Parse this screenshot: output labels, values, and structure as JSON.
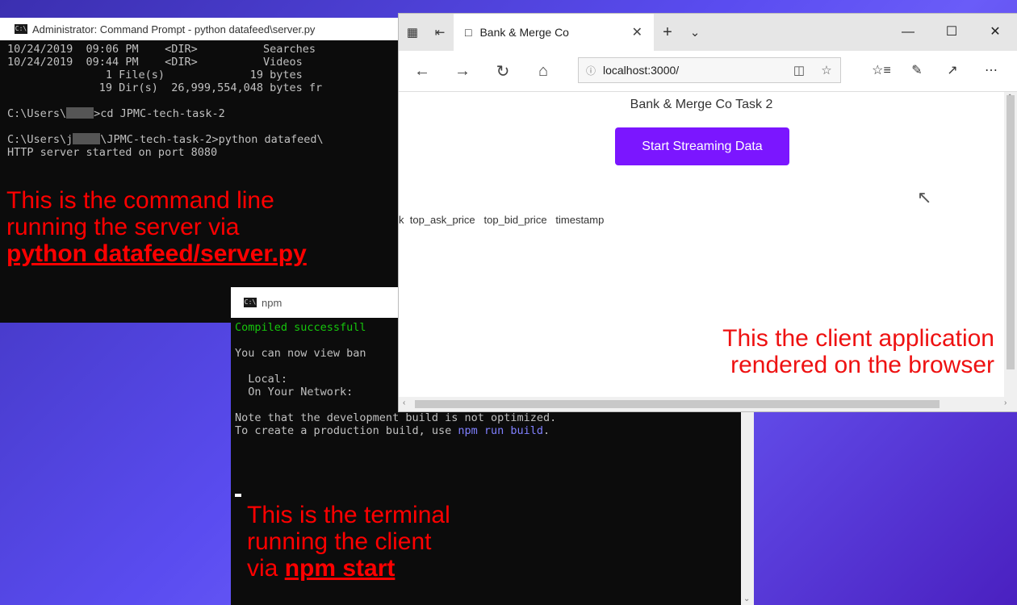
{
  "server_terminal": {
    "title": "Administrator: Command Prompt - python  datafeed\\server.py",
    "lines": [
      {
        "date": "10/24/2019",
        "time": "09:06 PM",
        "dir": "<DIR>",
        "name": "Searches"
      },
      {
        "date": "10/24/2019",
        "time": "09:44 PM",
        "dir": "<DIR>",
        "name": "Videos"
      }
    ],
    "files_line": "               1 File(s)             19 bytes",
    "dirs_line": "              19 Dir(s)  26,999,554,048 bytes fr",
    "prompt_prefix": "C:\\Users\\",
    "cmd1": ">cd JPMC-tech-task-2",
    "prompt2_prefix": "C:\\Users\\j",
    "cmd2": "\\JPMC-tech-task-2>python datafeed\\",
    "status": "HTTP server started on port 8080"
  },
  "npm_terminal": {
    "title": "npm",
    "compiled": "Compiled successfull",
    "view": "You can now view ban",
    "local": "  Local:",
    "network": "  On Your Network:",
    "note": "Note that the development build is not optimized.",
    "prod_prefix": "To create a production build, use ",
    "prod_cmd": "npm run build",
    "prod_suffix": "."
  },
  "browser": {
    "tab_title": "Bank & Merge Co",
    "url": "localhost:3000/",
    "page_heading": "Bank & Merge Co Task 2",
    "button_label": "Start Streaming Data",
    "column_headers": "k  top_ask_price   top_bid_price   timestamp"
  },
  "annotations": {
    "server": {
      "line1": "This is the command line",
      "line2": "running the server via",
      "command": "python datafeed/server.py"
    },
    "client": {
      "line1": "This the client application",
      "line2": "rendered on the browser"
    },
    "npm": {
      "line1": "This is the terminal",
      "line2": "running the client",
      "prefix": "via ",
      "command": "npm start"
    }
  },
  "colors": {
    "button": "#7b16ff",
    "annotation": "#ff0000",
    "compiled": "#16c60c"
  }
}
